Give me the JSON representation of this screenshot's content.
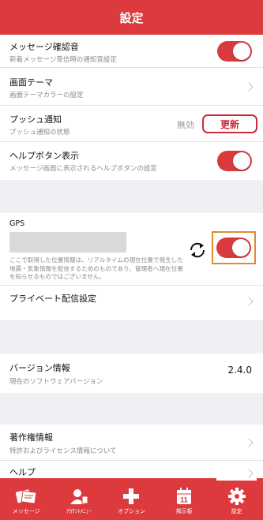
{
  "header": {
    "title": "設定"
  },
  "group1": {
    "items": [
      {
        "title": "メッセージ確認音",
        "subtitle": "新着メッセージ受信時の通知音設定"
      },
      {
        "title": "画面テーマ",
        "subtitle": "画面テーマカラーの設定"
      },
      {
        "title": "プッシュ通知",
        "subtitle": "プッシュ通知の状態",
        "status": "無効",
        "button": "更新"
      },
      {
        "title": "ヘルプボタン表示",
        "subtitle": "メッセージ画面に表示されるヘルプボタンの設定"
      }
    ],
    "toggles": {
      "message_sound": true,
      "help_button": true
    }
  },
  "gps": {
    "label": "GPS",
    "note": "ここで取得した位置情報は、リアルタイムの現在位置で発生した地震・気象情報を配信するためのものであり、管理者へ現在位置を知らせるものではございません。",
    "enabled": true,
    "private_label": "プライベート配信設定"
  },
  "version": {
    "title": "バージョン情報",
    "subtitle": "現在のソフトウェアバージョン",
    "value": "2.4.0"
  },
  "about": {
    "items": [
      {
        "title": "著作権情報",
        "subtitle": "特許およびライセンス情報について"
      },
      {
        "title": "ヘルプ"
      }
    ]
  },
  "tabbar": {
    "tabs": [
      {
        "label": "メッセージ",
        "icon": "messages-icon"
      },
      {
        "label": "ｱｶｳﾝﾄﾒﾆｭｰ",
        "icon": "account-icon"
      },
      {
        "label": "オプション",
        "icon": "plus-icon"
      },
      {
        "label": "掲示板",
        "icon": "calendar-icon",
        "badge": "11"
      },
      {
        "label": "設定",
        "icon": "gear-icon",
        "active": true
      }
    ]
  },
  "colors": {
    "brand": "#dc3a3c",
    "toggle": "#d93a3e",
    "highlight": "#e08a30",
    "background": "#efeff4"
  }
}
